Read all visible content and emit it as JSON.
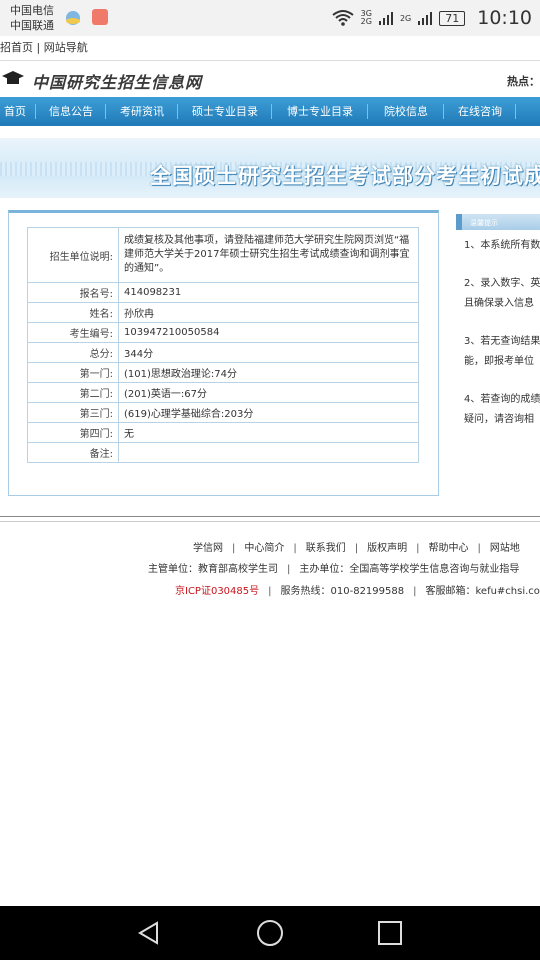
{
  "status_bar": {
    "carrier1": "中国电信",
    "carrier2": "中国联通",
    "net1": "3G",
    "net2": "2G",
    "net3": "2G",
    "battery": "71",
    "time": "10:10"
  },
  "top_links": "招首页 | 网站导航",
  "header": {
    "logo_text": "中国研究生招生信息网",
    "hot_label": "热点："
  },
  "nav": [
    "首页",
    "信息公告",
    "考研资讯",
    "硕士专业目录",
    "博士专业目录",
    "院校信息",
    "在线咨询"
  ],
  "banner_title": "全国硕士研究生招生考试部分考生初试成",
  "result": {
    "rows": [
      {
        "label": "招生单位说明:",
        "value": "成绩复核及其他事项，请登陆福建师范大学研究生院网页浏览“福建师范大学关于2017年硕士研究生招生考试成绩查询和调剂事宜的通知”。"
      },
      {
        "label": "报名号:",
        "value": "414098231"
      },
      {
        "label": "姓名:",
        "value": "孙欣冉"
      },
      {
        "label": "考生编号:",
        "value": "103947210050584"
      },
      {
        "label": "总分:",
        "value": "344分"
      },
      {
        "label": "第一门:",
        "value": "(101)思想政治理论:74分"
      },
      {
        "label": "第二门:",
        "value": "(201)英语一:67分"
      },
      {
        "label": "第三门:",
        "value": "(619)心理学基础综合:203分"
      },
      {
        "label": "第四门:",
        "value": "无"
      },
      {
        "label": "备注:",
        "value": ""
      }
    ]
  },
  "side": {
    "head": "温馨提示",
    "lines": [
      "1、本系统所有数",
      "2、录入数字、英",
      "且确保录入信息",
      "3、若无查询结果",
      "能，即报考单位",
      "4、若查询的成绩",
      "疑问，请咨询相"
    ]
  },
  "footer": {
    "links": [
      "学信网",
      "中心简介",
      "联系我们",
      "版权声明",
      "帮助中心",
      "网站地"
    ],
    "line2_a": "主管单位：教育部高校学生司",
    "line2_b": "主办单位：全国高等学校学生信息咨询与就业指导",
    "icp": "京ICP证030485号",
    "hotline": "服务热线：010-82199588",
    "email": "客服邮箱：kefu#chsi.com"
  },
  "colors": {
    "nav_blue": "#2a8bc8",
    "banner_blue": "#d2e9f7",
    "border_blue": "#a9cce6",
    "icp_red": "#c8161d"
  }
}
